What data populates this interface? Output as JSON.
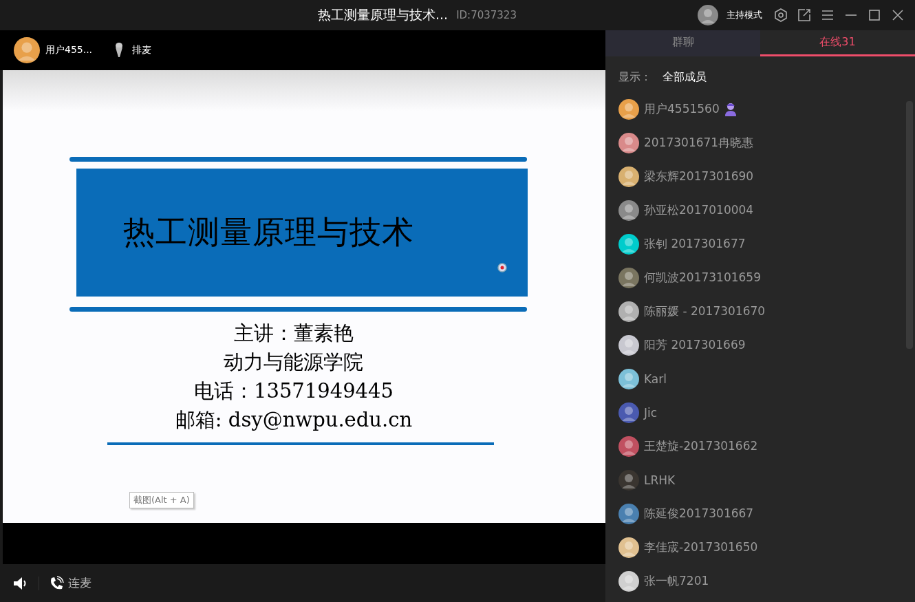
{
  "window": {
    "title": "热工测量原理与技术...",
    "room_id": "ID:7037323",
    "mode": "主持模式"
  },
  "presenter": {
    "name": "用户455...",
    "queue": "排麦"
  },
  "slide": {
    "title": "热工测量原理与技术",
    "lines": [
      "主讲：董素艳",
      "动力与能源学院",
      "电话：13571949445",
      "邮箱: dsy@nwpu.edu.cn"
    ]
  },
  "tooltip": "截图(Alt + A)",
  "bottom_bar": {
    "connect": "连麦"
  },
  "tabs": [
    {
      "label": "群聊",
      "selected": false
    },
    {
      "label": "在线31",
      "selected": true
    }
  ],
  "filter": {
    "label": "显示：",
    "value": "全部成员"
  },
  "members": [
    {
      "name": "用户4551560",
      "host": true
    },
    {
      "name": "2017301671冉晓惠",
      "host": false
    },
    {
      "name": "梁东辉2017301690",
      "host": false
    },
    {
      "name": "孙亚松2017010004",
      "host": false
    },
    {
      "name": "张钊 2017301677",
      "host": false
    },
    {
      "name": "何凯波20173101659",
      "host": false
    },
    {
      "name": "陈丽媛 - 2017301670",
      "host": false
    },
    {
      "name": "阳芳 2017301669",
      "host": false
    },
    {
      "name": "Karl",
      "host": false
    },
    {
      "name": "Jic",
      "host": false
    },
    {
      "name": "王楚旋-2017301662",
      "host": false
    },
    {
      "name": "LRHK",
      "host": false
    },
    {
      "name": "陈延俊2017301667",
      "host": false
    },
    {
      "name": "李佳宬-2017301650",
      "host": false
    },
    {
      "name": "张一帆7201",
      "host": false
    }
  ]
}
